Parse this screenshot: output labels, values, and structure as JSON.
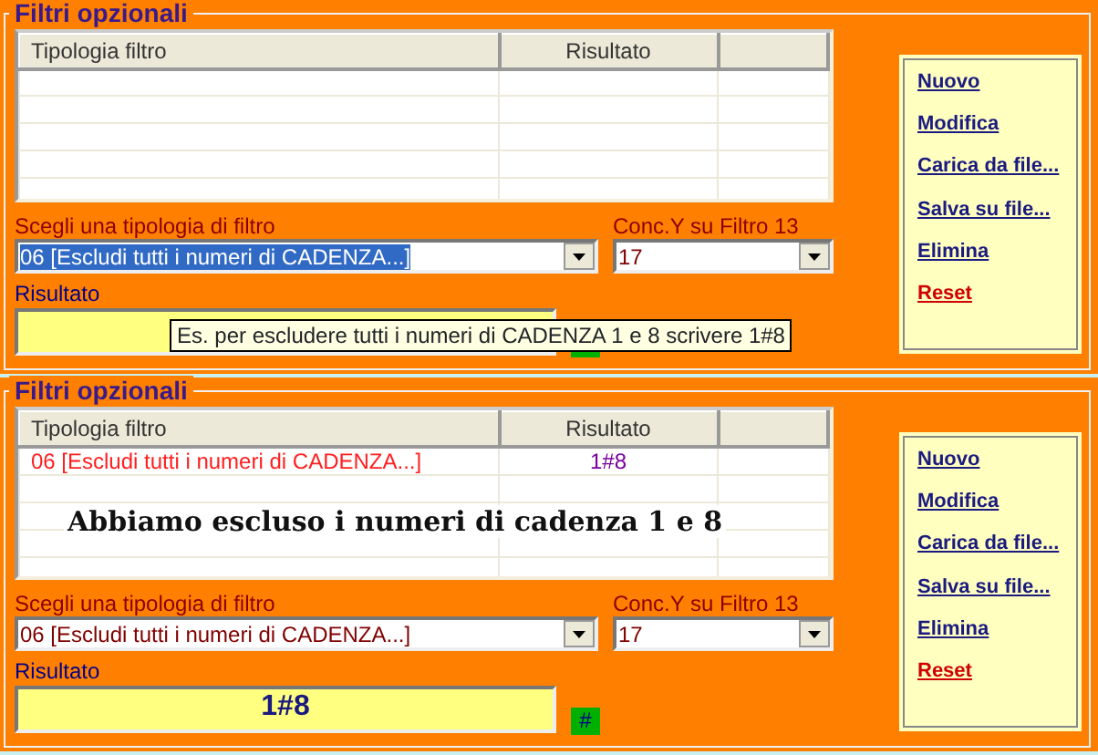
{
  "panels": [
    {
      "title": "Filtri opzionali",
      "columns": [
        "Tipologia filtro",
        "Risultato"
      ],
      "rows": [
        {
          "cells": [
            "",
            ""
          ]
        },
        {
          "cells": [
            "",
            ""
          ]
        },
        {
          "cells": [
            "",
            ""
          ]
        },
        {
          "cells": [
            "",
            ""
          ]
        },
        {
          "cells": [
            "",
            ""
          ]
        }
      ],
      "filter_label": "Scegli una tipologia di filtro",
      "filter_value": "06 [Escludi tutti i numeri di CADENZA...]",
      "filter_text_selected": true,
      "conc_label": "Conc.Y su Filtro 13",
      "conc_value": "17",
      "result_label": "Risultato",
      "tooltip": "Es. per escludere tutti i numeri di CADENZA 1 e 8 scrivere 1#8",
      "actions": [
        {
          "label": "Nuovo",
          "kind": "normal"
        },
        {
          "label": "Modifica",
          "kind": "normal"
        },
        {
          "label": "Carica da file...",
          "kind": "normal"
        },
        {
          "label": "Salva su file...",
          "kind": "normal"
        },
        {
          "label": "Elimina",
          "kind": "normal"
        },
        {
          "label": "Reset",
          "kind": "danger"
        }
      ]
    },
    {
      "title": "Filtri opzionali",
      "columns": [
        "Tipologia filtro",
        "Risultato"
      ],
      "rows": [
        {
          "cells": [
            "06 [Escludi tutti i numeri di CADENZA...]",
            "1#8"
          ]
        },
        {
          "cells": [
            "",
            ""
          ]
        },
        {
          "cells": [
            "",
            ""
          ]
        },
        {
          "cells": [
            "",
            ""
          ]
        },
        {
          "cells": [
            "",
            ""
          ]
        }
      ],
      "annotation": "Abbiamo escluso i numeri di cadenza 1 e 8",
      "filter_label": "Scegli una tipologia di filtro",
      "filter_value": "06 [Escludi tutti i numeri di CADENZA...]",
      "filter_text_selected": false,
      "conc_label": "Conc.Y su Filtro 13",
      "conc_value": "17",
      "result_label": "Risultato",
      "result_value": "1#8",
      "hash_label": "#",
      "actions": [
        {
          "label": "Nuovo",
          "kind": "normal"
        },
        {
          "label": "Modifica",
          "kind": "normal"
        },
        {
          "label": "Carica da file...",
          "kind": "normal"
        },
        {
          "label": "Salva su file...",
          "kind": "normal"
        },
        {
          "label": "Elimina",
          "kind": "normal"
        },
        {
          "label": "Reset",
          "kind": "danger"
        }
      ]
    }
  ]
}
